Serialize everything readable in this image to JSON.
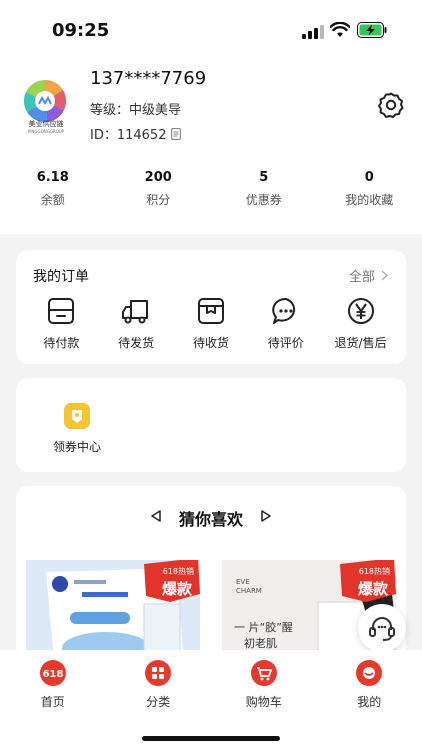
{
  "status_bar": {
    "time": "09:25"
  },
  "profile": {
    "avatar_caption": "美业供应链",
    "avatar_sub": "PINGGONGGROUP",
    "phone": "137****7769",
    "level": "等级：中级美导",
    "id": "ID：114652"
  },
  "stats": [
    {
      "value": "6.18",
      "label": "余额"
    },
    {
      "value": "200",
      "label": "积分"
    },
    {
      "value": "5",
      "label": "优惠券"
    },
    {
      "value": "0",
      "label": "我的收藏"
    }
  ],
  "orders": {
    "title": "我的订单",
    "all": "全部",
    "items": [
      {
        "label": "待付款",
        "icon": "wallet-icon"
      },
      {
        "label": "待发货",
        "icon": "truck-icon"
      },
      {
        "label": "待收货",
        "icon": "box-icon"
      },
      {
        "label": "待评价",
        "icon": "comment-icon"
      },
      {
        "label": "退货/售后",
        "icon": "yen-icon"
      }
    ]
  },
  "coupon_center": {
    "label": "领券中心"
  },
  "guess_like": {
    "title": "猜你喜欢",
    "products": [
      {
        "badge_top": "618热销",
        "badge_main": "爆款",
        "brand_text": ""
      },
      {
        "badge_top": "618热销",
        "badge_main": "爆款",
        "brand_line1": "EVE",
        "brand_line2": "CHARM",
        "slogan1": "一 片“胶”醒",
        "slogan2": "初老肌"
      }
    ]
  },
  "tabbar": [
    {
      "label": "首页",
      "icon": "home-618-icon"
    },
    {
      "label": "分类",
      "icon": "category-icon"
    },
    {
      "label": "购物车",
      "icon": "cart-icon"
    },
    {
      "label": "我的",
      "icon": "profile-icon"
    }
  ],
  "colors": {
    "accent": "#e8392f",
    "badge": "#e3342b",
    "coupon_icon": "#f5c533"
  }
}
